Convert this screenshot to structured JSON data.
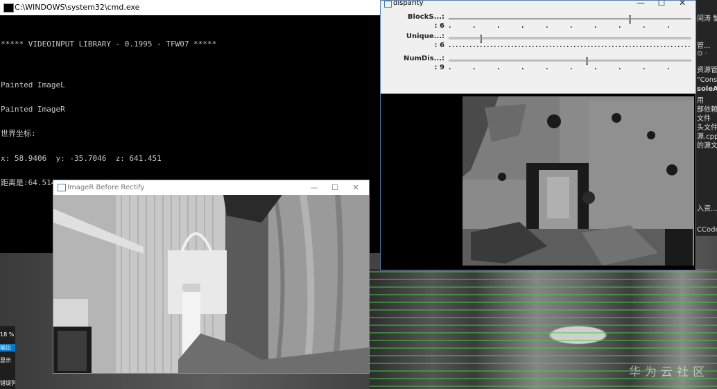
{
  "cmd_window": {
    "title": "C:\\WINDOWS\\system32\\cmd.exe",
    "lines": [
      "***** VIDEOINPUT LIBRARY - 0.1995 - TFW07 *****",
      "",
      "Painted ImageL",
      "Painted ImageR",
      "世界坐标:",
      "x: 58.9406  y: -35.7046  z: 641.451",
      "距离是:64.5142cm"
    ]
  },
  "disparity_window": {
    "title": "disparity",
    "trackbars": [
      {
        "name": "BlockS...:",
        "value": ": 6",
        "fraction": 0.75
      },
      {
        "name": "Unique...:",
        "value": ": 6",
        "fraction": 0.13
      },
      {
        "name": "NumDis...:",
        "value": ": 9",
        "fraction": 0.57
      }
    ]
  },
  "imager_window": {
    "title": "ImageR Before Rectify"
  },
  "window_controls": {
    "minimize": "—",
    "maximize": "☐",
    "close": "✕"
  },
  "ide_right": {
    "items": [
      "闰涛 黎",
      "管...",
      "⊙ ·",
      "资源管理",
      "\"Conso",
      "soleAp",
      "用",
      "部依赖",
      "文件",
      "头文件",
      "源.cpp",
      "的源文件",
      "入资...",
      "CCodeN"
    ]
  },
  "left_strip": {
    "items": [
      "18 %",
      "输出",
      "显示",
      "错误列"
    ]
  },
  "watermark": "华为云社区",
  "colors": {
    "cmd_bg": "#000000",
    "console_text": "#c8c8c8",
    "rectify_lines": "#3cd23c",
    "disparity_border": "#5a7fa8"
  }
}
